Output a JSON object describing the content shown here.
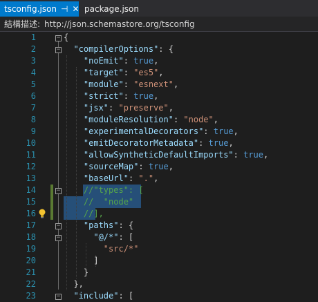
{
  "tabs": {
    "active_label": "tsconfig.json",
    "pin_glyph": "⊣",
    "close_glyph": "✕",
    "inactive_label": "package.json"
  },
  "schema": {
    "label": "結構描述:",
    "url": "http://json.schemastore.org/tsconfig"
  },
  "editor": {
    "line_numbers": [
      "1",
      "2",
      "3",
      "4",
      "5",
      "6",
      "7",
      "8",
      "9",
      "10",
      "11",
      "12",
      "13",
      "14",
      "15",
      "16",
      "17",
      "18",
      "19",
      "20",
      "21",
      "22",
      "23"
    ],
    "lines": [
      "{",
      "  \"compilerOptions\": {",
      "    \"noEmit\": true,",
      "    \"target\": \"es5\",",
      "    \"module\": \"esnext\",",
      "    \"strict\": true,",
      "    \"jsx\": \"preserve\",",
      "    \"moduleResolution\": \"node\",",
      "    \"experimentalDecorators\": true,",
      "    \"emitDecoratorMetadata\": true,",
      "    \"allowSyntheticDefaultImports\": true,",
      "    \"sourceMap\": true,",
      "    \"baseUrl\": \".\",",
      "    //\"types\": [",
      "    //  \"node\"",
      "    //],",
      "    \"paths\": {",
      "      \"@/*\": [",
      "        \"src/*\"",
      "      ]",
      "    }",
      "  },",
      "  \"include\": ["
    ]
  }
}
